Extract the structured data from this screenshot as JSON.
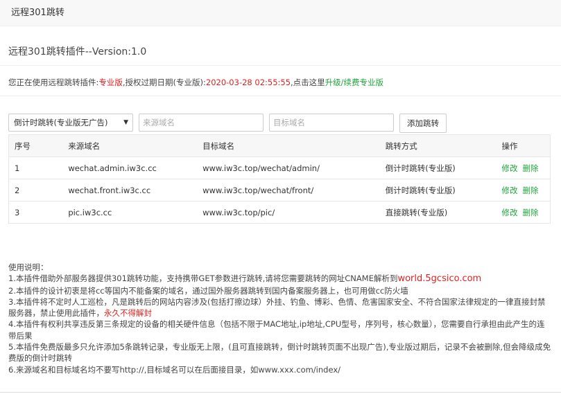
{
  "window": {
    "title": "远程301跳转"
  },
  "plugin": {
    "title": "远程301跳转插件--Version:1.0"
  },
  "license": {
    "prefix": "您正在使用远程跳转插件:",
    "edition": "专业版",
    "expire_label": ",授权过期日期(专业版):",
    "expire_date": "2020-03-28 02:55:55",
    "click_text": ",点击这里",
    "upgrade_link": "升级/续费专业版",
    "accent_red": "#e02020",
    "accent_green": "#20a53a"
  },
  "form": {
    "mode_selected": "倒计时跳转(专业版无广告)",
    "source_placeholder": "来源域名",
    "target_placeholder": "目标域名",
    "add_label": "添加跳转"
  },
  "table": {
    "headers": [
      "序号",
      "来源域名",
      "目标域名",
      "跳转方式",
      "操作"
    ],
    "rows": [
      {
        "id": "1",
        "source": "wechat.admin.iw3c.cc",
        "target": "www.iw3c.top/wechat/admin/",
        "method": "倒计时跳转(专业版)"
      },
      {
        "id": "2",
        "source": "wechat.front.iw3c.cc",
        "target": "www.iw3c.top/wechat/front/",
        "method": "倒计时跳转(专业版)"
      },
      {
        "id": "3",
        "source": "pic.iw3c.cc",
        "target": "www.iw3c.top/pic/",
        "method": "直接跳转(专业版)"
      }
    ],
    "edit_label": "修改",
    "delete_label": "删除"
  },
  "notes": {
    "title": "使用说明：",
    "line1": "1.本插件借助外部服务器提供301跳转功能，支持携带GET参数进行跳转,请将您需要跳转的网址CNAME解析到",
    "line1_domain": "world.5gcsico.com",
    "line2": "2.本插件的设计初衷是将cc等国内不能备案的域名，通过国外服务器跳转到国内备案服务器上，也可用做cc防火墙",
    "line3": "3.本插件将不定时人工巡检，凡是跳转后的网站内容涉及(包括打擦边球）外挂、钓鱼、博彩、色情、危害国家安全、不符合国家法律规定的一律直接封禁服务器，禁止使用此插件，",
    "line3_warning": "永久不得解封",
    "line4": "4.本插件有权利共享违反第三条规定的设备的相关硬件信息（包括不限于MAC地址,ip地址,CPU型号，序列号，核心数量），您需要自行承担由此产生的连带后果",
    "line5": "5.本插件免费版最多只允许添加5条跳转记录，专业版无上限，(且可直接跳转，倒计时跳转页面不出现广告),专业版过期后，记录不会被删除,但会降级成免费版的倒计时跳转",
    "line6": "6.来源域名和目标域名均不要写http://,目标域名可以在后面接目录，如www.xxx.com/index/"
  }
}
